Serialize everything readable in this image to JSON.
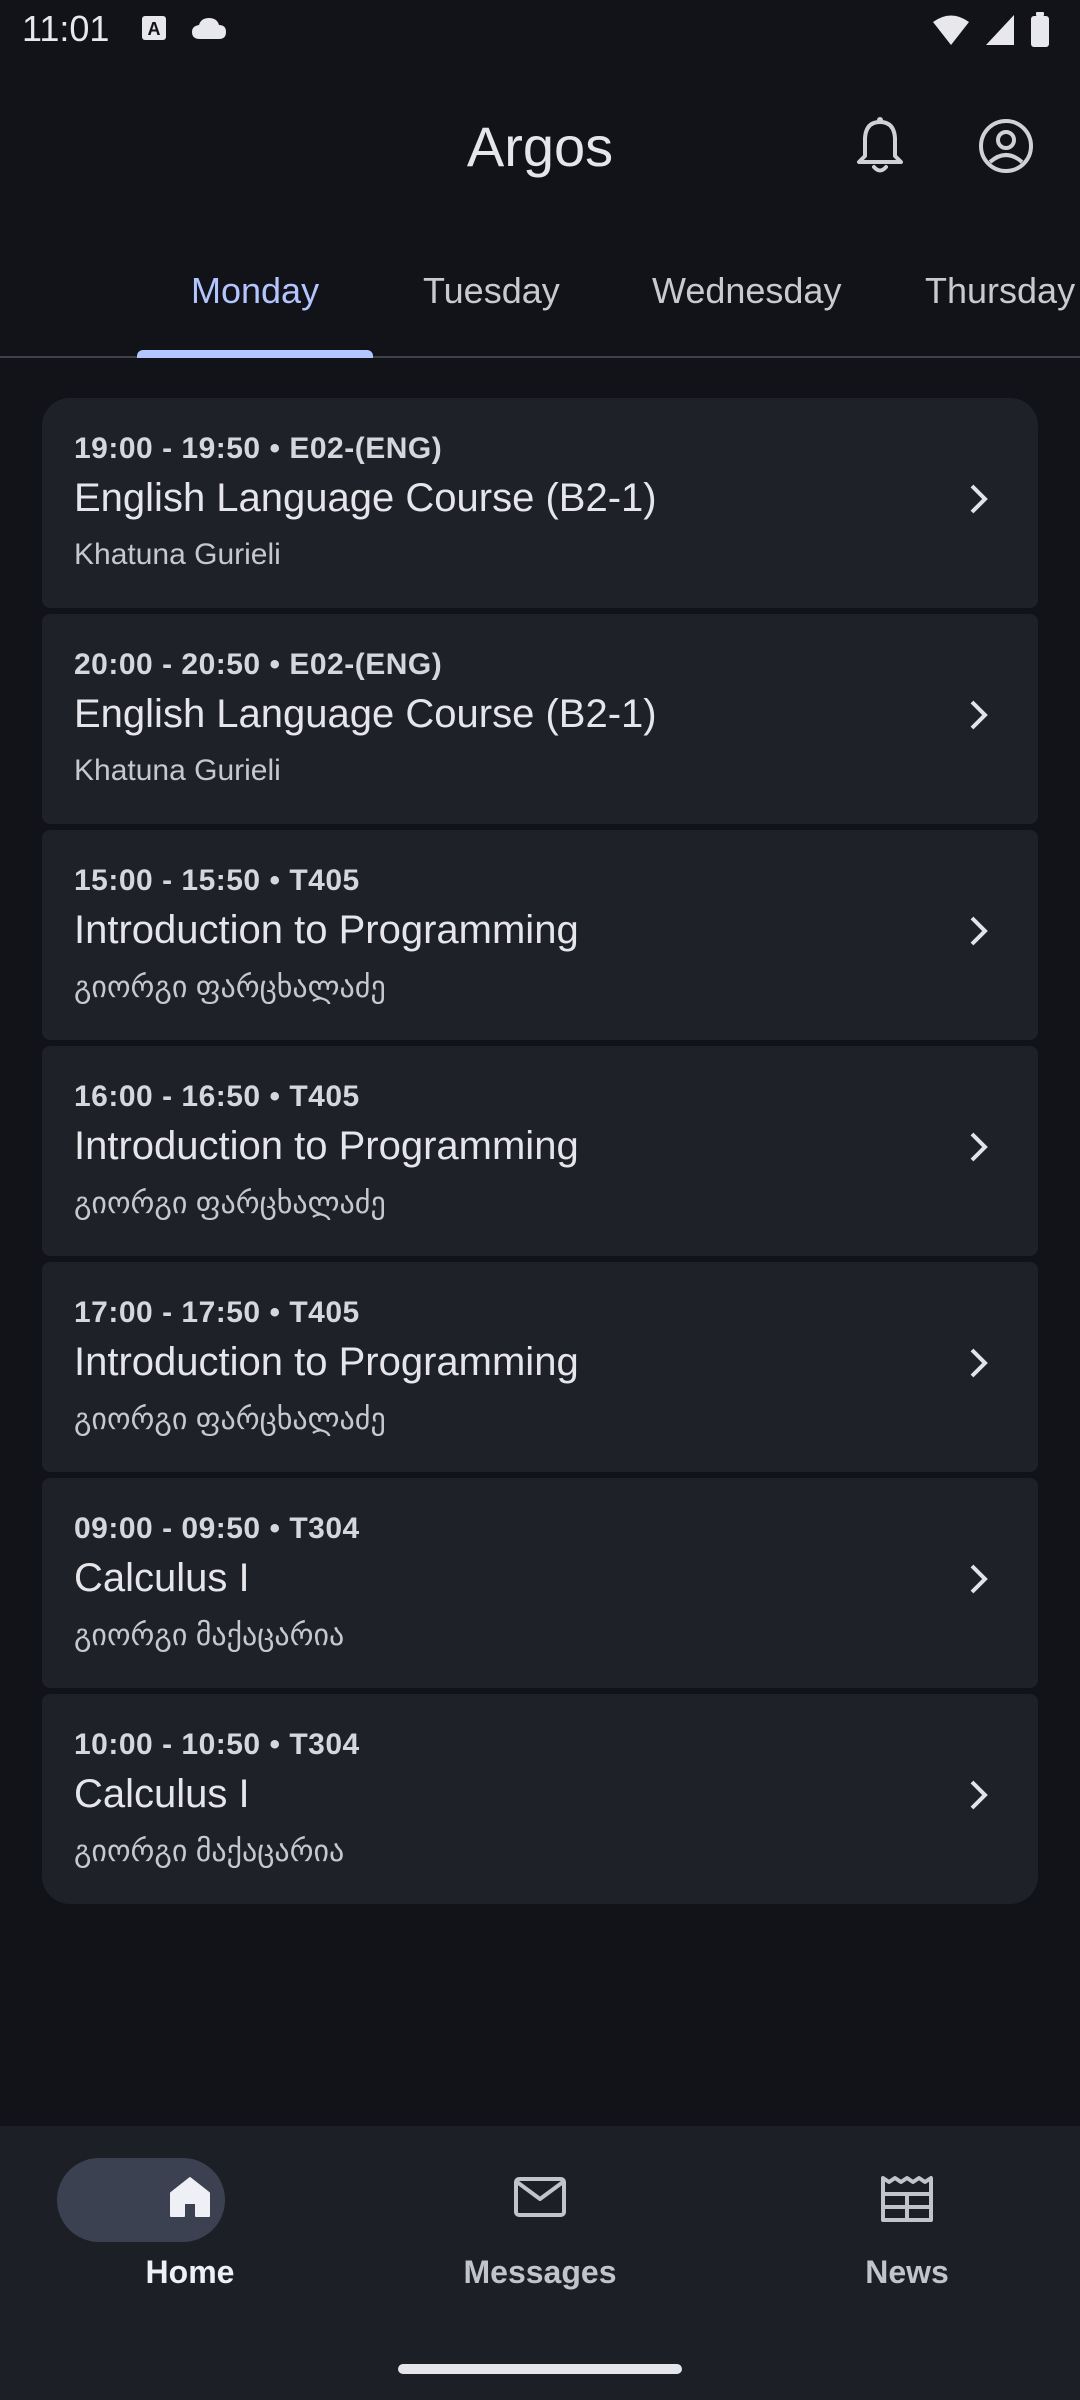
{
  "status_bar": {
    "time": "11:01",
    "left_icons": [
      "text-a-icon",
      "cloud-icon"
    ],
    "right_icons": [
      "wifi-icon",
      "signal-icon",
      "battery-icon"
    ]
  },
  "app_bar": {
    "title": "Argos",
    "actions": [
      "bell-icon",
      "account-icon"
    ]
  },
  "tabs": [
    {
      "label": "Monday",
      "selected": true
    },
    {
      "label": "Tuesday",
      "selected": false
    },
    {
      "label": "Wednesday",
      "selected": false
    },
    {
      "label": "Thursday",
      "selected": false
    }
  ],
  "classes": [
    {
      "time": "19:00 - 19:50",
      "room": "E02-(ENG)",
      "title": "English Language Course (B2-1)",
      "teacher": "Khatuna Gurieli"
    },
    {
      "time": "20:00 - 20:50",
      "room": "E02-(ENG)",
      "title": "English Language Course (B2-1)",
      "teacher": "Khatuna Gurieli"
    },
    {
      "time": "15:00 - 15:50",
      "room": "T405",
      "title": "Introduction to Programming",
      "teacher": "გიორგი ფარცხალაძე"
    },
    {
      "time": "16:00 - 16:50",
      "room": "T405",
      "title": "Introduction to Programming",
      "teacher": "გიორგი ფარცხალაძე"
    },
    {
      "time": "17:00 - 17:50",
      "room": "T405",
      "title": "Introduction to Programming",
      "teacher": "გიორგი ფარცხალაძე"
    },
    {
      "time": "09:00 - 09:50",
      "room": "T304",
      "title": "Calculus I",
      "teacher": "გიორგი მაქაცარია"
    },
    {
      "time": "10:00 - 10:50",
      "room": "T304",
      "title": "Calculus I",
      "teacher": "გიორგი მაქაცარია"
    }
  ],
  "meta_separator": "•",
  "bottom_nav": [
    {
      "label": "Home",
      "icon": "home-icon",
      "selected": true
    },
    {
      "label": "Messages",
      "icon": "mail-icon",
      "selected": false
    },
    {
      "label": "News",
      "icon": "newspaper-icon",
      "selected": false
    }
  ],
  "colors": {
    "background": "#111318",
    "card": "#1f2129",
    "accent": "#b3c5ff",
    "nav_background": "#1d1f26",
    "nav_pill": "#3b4150"
  }
}
